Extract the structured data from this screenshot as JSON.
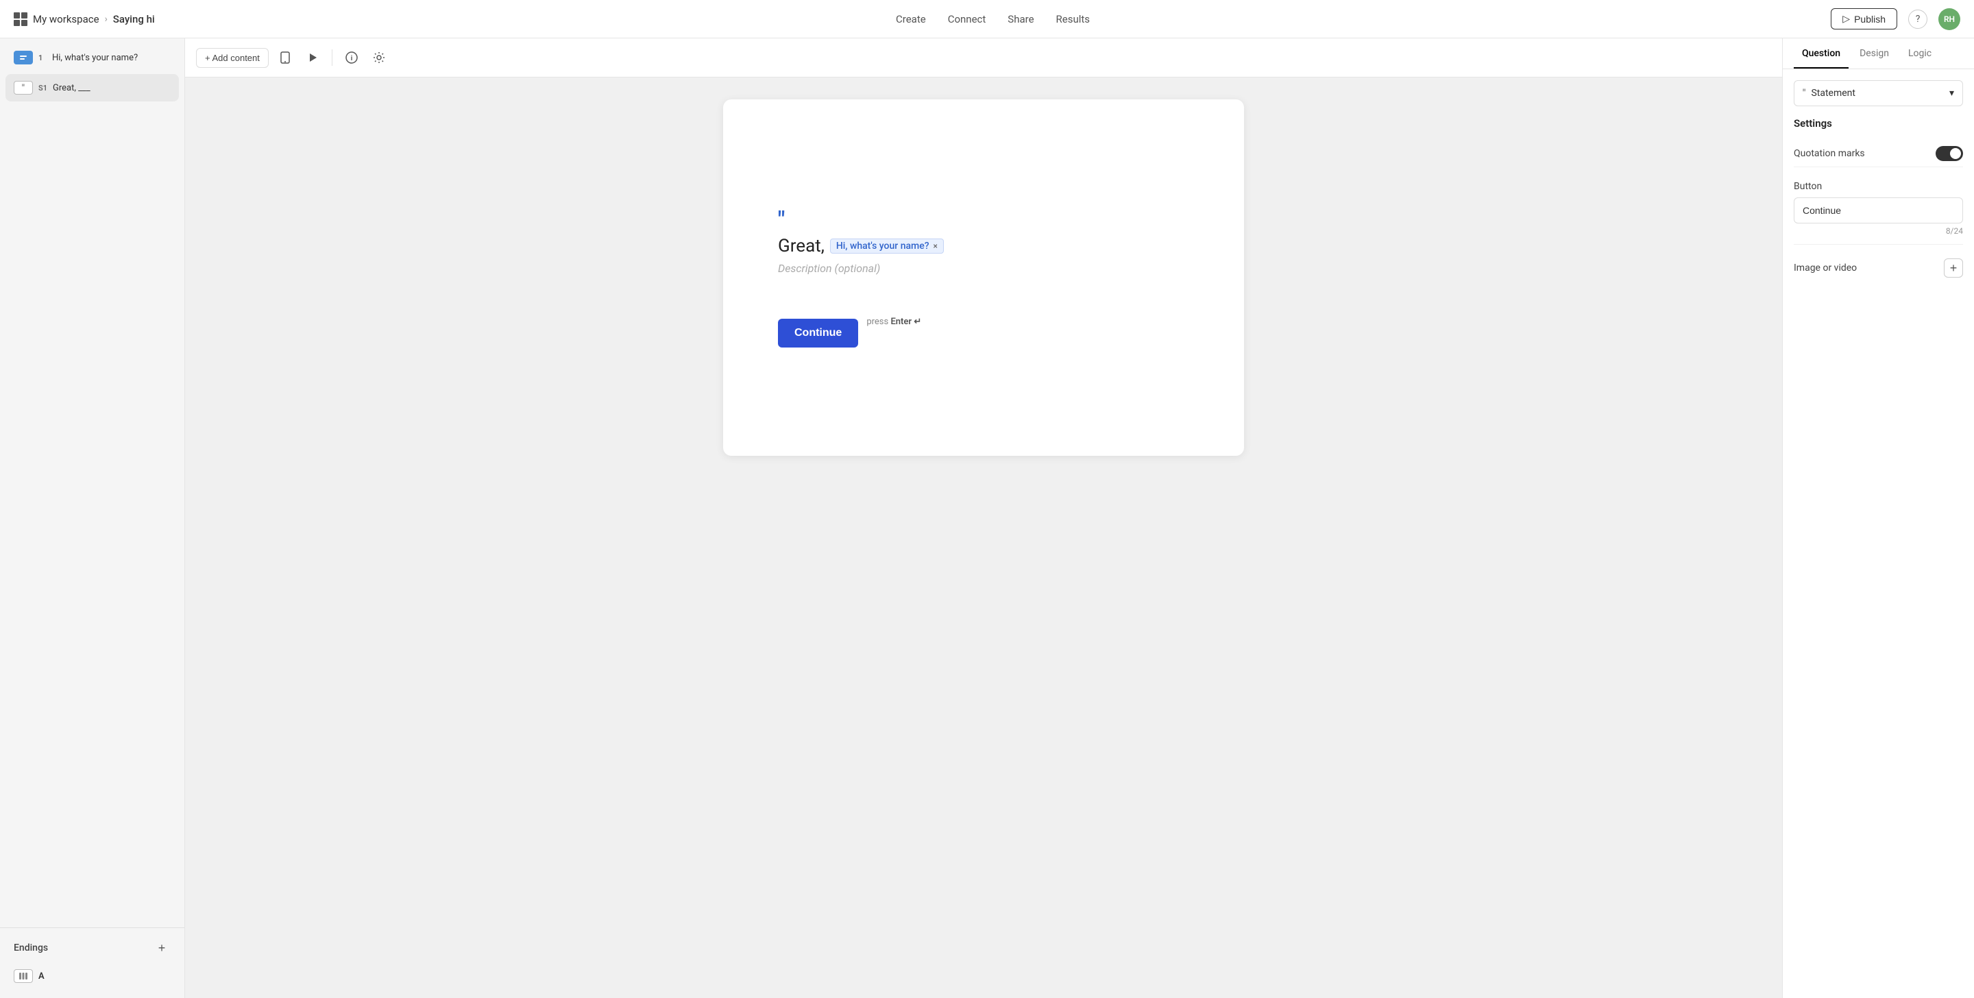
{
  "nav": {
    "workspace_icon_alt": "grid-icon",
    "workspace_label": "My workspace",
    "breadcrumb_sep": "›",
    "page_title": "Saying hi",
    "tabs": [
      {
        "id": "create",
        "label": "Create",
        "active": false
      },
      {
        "id": "connect",
        "label": "Connect",
        "active": false
      },
      {
        "id": "share",
        "label": "Share",
        "active": false
      },
      {
        "id": "results",
        "label": "Results",
        "active": false
      }
    ],
    "publish_label": "Publish",
    "help_label": "?",
    "avatar_initials": "RH"
  },
  "sidebar": {
    "questions": [
      {
        "id": "q1",
        "num": "1",
        "label": "Hi, what's your name?",
        "type": "question"
      },
      {
        "id": "s1",
        "num": "S1",
        "label": "Great, ___",
        "type": "statement",
        "active": true
      }
    ],
    "endings_title": "Endings",
    "endings": [
      {
        "id": "a",
        "label": "A"
      }
    ],
    "add_label": "+"
  },
  "toolbar": {
    "add_content_label": "+ Add content",
    "mobile_icon": "mobile-icon",
    "play_icon": "play-icon",
    "info_icon": "info-icon",
    "settings_icon": "settings-icon"
  },
  "canvas": {
    "quote_symbol": "\"",
    "statement_text": "Great,",
    "variable_chip_label": "Hi, what's your name?",
    "description_placeholder": "Description (optional)",
    "continue_button_label": "Continue",
    "press_enter_text": "press",
    "enter_key": "Enter ↵"
  },
  "right_panel": {
    "tabs": [
      {
        "id": "question",
        "label": "Question",
        "active": true
      },
      {
        "id": "design",
        "label": "Design",
        "active": false
      },
      {
        "id": "logic",
        "label": "Logic",
        "active": false
      }
    ],
    "type_dropdown": {
      "icon": "quote-icon",
      "label": "Statement",
      "chevron": "▾"
    },
    "settings_title": "Settings",
    "settings_rows": [
      {
        "id": "quotation_marks",
        "label": "Quotation marks",
        "toggle": true
      }
    ],
    "button_section": {
      "label": "Button",
      "value": "Continue",
      "char_count": "8/24"
    },
    "image_video": {
      "label": "Image or video",
      "add_icon": "+"
    }
  }
}
